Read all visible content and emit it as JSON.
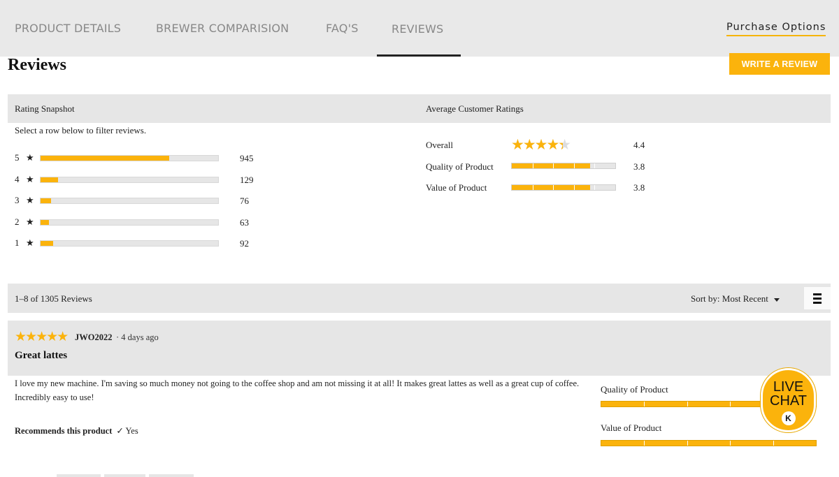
{
  "nav": {
    "tabs": [
      "PRODUCT DETAILS",
      "BREWER COMPARISION",
      "FAQ'S",
      "REVIEWS"
    ],
    "purchase_options": "Purchase Options"
  },
  "page": {
    "title": "Reviews",
    "write_review": "WRITE A REVIEW"
  },
  "snapshot": {
    "heading": "Rating Snapshot",
    "hint": "Select a row below to filter reviews.",
    "star_glyph": "★",
    "rows": [
      {
        "stars": "5",
        "count": "945",
        "fraction": 0.724
      },
      {
        "stars": "4",
        "count": "129",
        "fraction": 0.099
      },
      {
        "stars": "3",
        "count": "76",
        "fraction": 0.058
      },
      {
        "stars": "2",
        "count": "63",
        "fraction": 0.048
      },
      {
        "stars": "1",
        "count": "92",
        "fraction": 0.07
      }
    ]
  },
  "average": {
    "heading": "Average Customer Ratings",
    "overall": {
      "label": "Overall",
      "value": "4.4",
      "rating": 4.4
    },
    "quality": {
      "label": "Quality of Product",
      "value": "3.8",
      "rating": 3.8
    },
    "value": {
      "label": "Value of Product",
      "value": "3.8",
      "rating": 3.8
    }
  },
  "reviews_bar": {
    "count_text": "1–8 of 1305 Reviews",
    "sort_text": "Sort by: Most Recent"
  },
  "review": {
    "stars": "★★★★★",
    "user": "JWO2022",
    "date": "· 4 days ago",
    "title": "Great lattes",
    "body": "I love my new machine. I'm saving so much money not going to the coffee shop and am not missing it at all! It makes great lattes as well as a great cup of coffee. Incredibly easy to use!",
    "recommend_label": "Recommends this product",
    "recommend_value": "✓ Yes",
    "quality_label": "Quality of Product",
    "value_label": "Value of Product"
  },
  "live_chat": {
    "line1": "LIVE",
    "line2": "CHAT",
    "badge": "K"
  },
  "colors": {
    "accent": "#fbb30c",
    "panel": "#e6e6e6"
  }
}
